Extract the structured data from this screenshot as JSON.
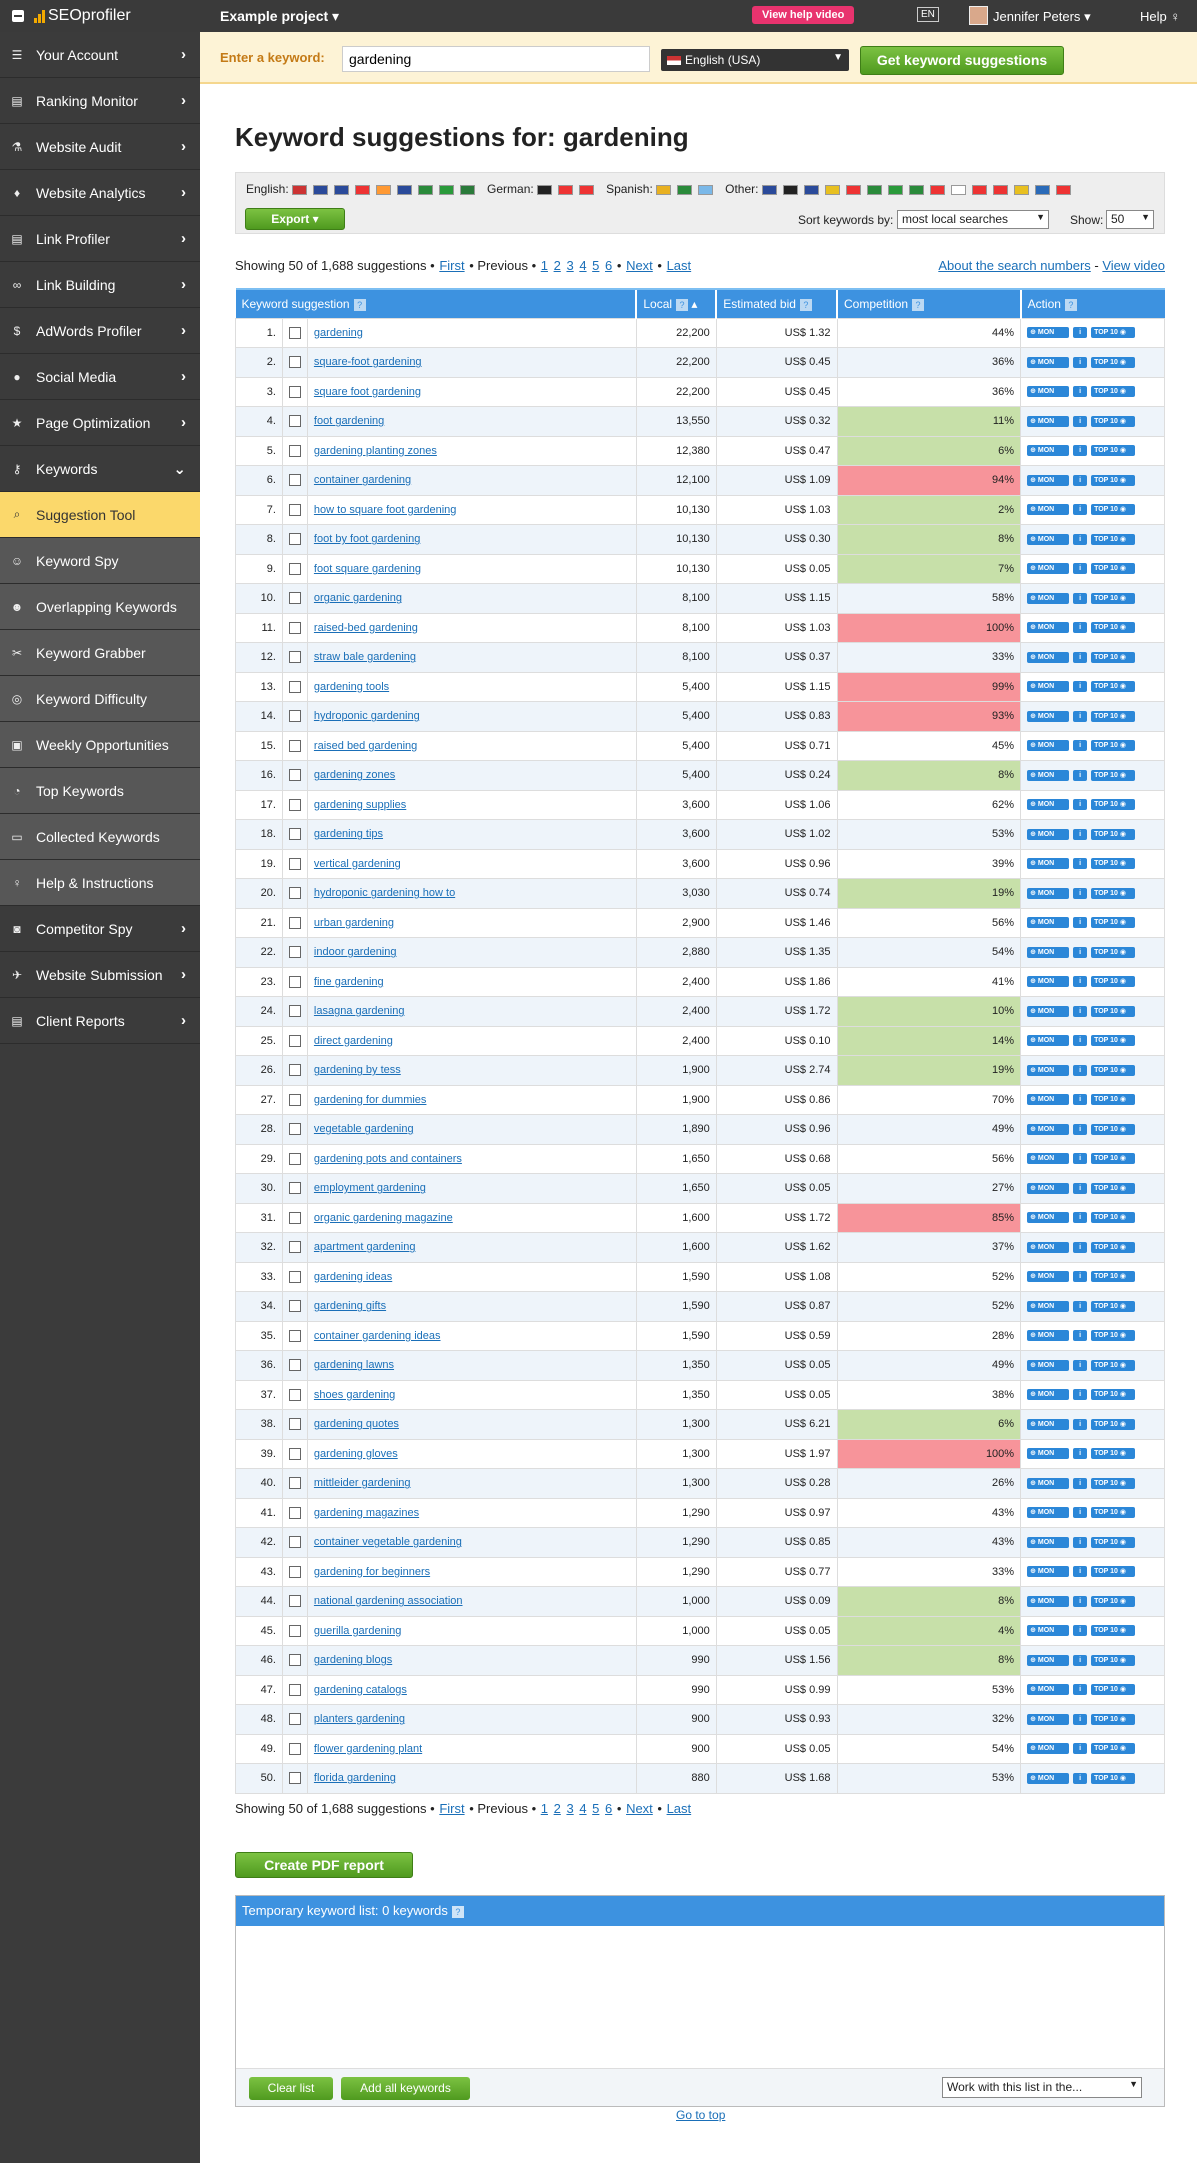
{
  "topbar": {
    "brand": "SEOprofiler",
    "project": "Example project",
    "help_video": "View help video",
    "lang": "EN",
    "user": "Jennifer Peters",
    "help": "Help"
  },
  "sidebar": {
    "items": [
      {
        "label": "Your Account",
        "icon": "list-icon",
        "chevron": ">"
      },
      {
        "label": "Ranking Monitor",
        "icon": "chart-icon",
        "chevron": ">"
      },
      {
        "label": "Website Audit",
        "icon": "flask-icon",
        "chevron": ">"
      },
      {
        "label": "Website Analytics",
        "icon": "pin-icon",
        "chevron": ">"
      },
      {
        "label": "Link Profiler",
        "icon": "chart-icon",
        "chevron": ">"
      },
      {
        "label": "Link Building",
        "icon": "link-icon",
        "chevron": ">"
      },
      {
        "label": "AdWords Profiler",
        "icon": "dollar-icon",
        "chevron": ">"
      },
      {
        "label": "Social Media",
        "icon": "comment-icon",
        "chevron": ">"
      },
      {
        "label": "Page Optimization",
        "icon": "star-icon",
        "chevron": ">"
      },
      {
        "label": "Keywords",
        "icon": "key-icon",
        "chevron": "v"
      }
    ],
    "subitems": [
      {
        "label": "Suggestion Tool",
        "icon": "search-icon",
        "active": true
      },
      {
        "label": "Keyword Spy",
        "icon": "user-icon"
      },
      {
        "label": "Overlapping Keywords",
        "icon": "users-icon"
      },
      {
        "label": "Keyword Grabber",
        "icon": "scissors-icon"
      },
      {
        "label": "Keyword Difficulty",
        "icon": "target-icon"
      },
      {
        "label": "Weekly Opportunities",
        "icon": "gift-icon"
      },
      {
        "label": "Top Keywords",
        "icon": "pie-icon"
      },
      {
        "label": "Collected Keywords",
        "icon": "inbox-icon"
      },
      {
        "label": "Help & Instructions",
        "icon": "bulb-icon"
      }
    ],
    "items2": [
      {
        "label": "Competitor Spy",
        "icon": "camera-icon",
        "chevron": ">"
      },
      {
        "label": "Website Submission",
        "icon": "plane-icon",
        "chevron": ">"
      },
      {
        "label": "Client Reports",
        "icon": "doc-icon",
        "chevron": ">"
      }
    ]
  },
  "keyword_bar": {
    "label": "Enter a keyword:",
    "value": "gardening",
    "language": "English (USA)",
    "button": "Get keyword suggestions"
  },
  "main": {
    "title": "Keyword suggestions for: gardening",
    "lang_groups": [
      {
        "label": "English:",
        "flags": [
          "#c33",
          "#2a4a9a",
          "#2a4a9a",
          "#e33",
          "#f93",
          "#2a4a9a",
          "#2a8a3a",
          "#2a9a3a",
          "#2a7a3a"
        ]
      },
      {
        "label": "German:",
        "flags": [
          "#222",
          "#e33",
          "#e33"
        ]
      },
      {
        "label": "Spanish:",
        "flags": [
          "#e8b020",
          "#2a8a3a",
          "#7ab8e8"
        ]
      },
      {
        "label": "Other:",
        "flags": [
          "#2a4a9a",
          "#222",
          "#2a4a9a",
          "#e8c020",
          "#e33",
          "#2a8a3a",
          "#2a9a3a",
          "#2a8a3a",
          "#e33",
          "#fff",
          "#e33",
          "#e33",
          "#e8c020",
          "#2a6ab8",
          "#e33"
        ]
      }
    ],
    "export": "Export",
    "sort_label": "Sort keywords by:",
    "sort_value": "most local searches",
    "show_label": "Show:",
    "show_value": "50",
    "pager": {
      "showing": "Showing 50 of 1,688 suggestions",
      "first": "First",
      "previous": "Previous",
      "pages": [
        "1",
        "2",
        "3",
        "4",
        "5",
        "6"
      ],
      "next": "Next",
      "last": "Last"
    },
    "about": "About the search numbers",
    "view_video": "View video",
    "columns": [
      "Keyword suggestion",
      "Local",
      "Estimated bid",
      "Competition",
      "Action"
    ],
    "actions": {
      "mon": "MON",
      "info": "i",
      "top": "TOP 10"
    },
    "rows": [
      {
        "n": "1.",
        "kw": "gardening",
        "local": "22,200",
        "bid": "US$ 1.32",
        "comp": "44%",
        "c": ""
      },
      {
        "n": "2.",
        "kw": "square-foot gardening",
        "local": "22,200",
        "bid": "US$ 0.45",
        "comp": "36%",
        "c": ""
      },
      {
        "n": "3.",
        "kw": "square foot gardening",
        "local": "22,200",
        "bid": "US$ 0.45",
        "comp": "36%",
        "c": ""
      },
      {
        "n": "4.",
        "kw": "foot gardening",
        "local": "13,550",
        "bid": "US$ 0.32",
        "comp": "11%",
        "c": "green"
      },
      {
        "n": "5.",
        "kw": "gardening planting zones",
        "local": "12,380",
        "bid": "US$ 0.47",
        "comp": "6%",
        "c": "green"
      },
      {
        "n": "6.",
        "kw": "container gardening",
        "local": "12,100",
        "bid": "US$ 1.09",
        "comp": "94%",
        "c": "red"
      },
      {
        "n": "7.",
        "kw": "how to square foot gardening",
        "local": "10,130",
        "bid": "US$ 1.03",
        "comp": "2%",
        "c": "green"
      },
      {
        "n": "8.",
        "kw": "foot by foot gardening",
        "local": "10,130",
        "bid": "US$ 0.30",
        "comp": "8%",
        "c": "green"
      },
      {
        "n": "9.",
        "kw": "foot square gardening",
        "local": "10,130",
        "bid": "US$ 0.05",
        "comp": "7%",
        "c": "green"
      },
      {
        "n": "10.",
        "kw": "organic gardening",
        "local": "8,100",
        "bid": "US$ 1.15",
        "comp": "58%",
        "c": ""
      },
      {
        "n": "11.",
        "kw": "raised-bed gardening",
        "local": "8,100",
        "bid": "US$ 1.03",
        "comp": "100%",
        "c": "red"
      },
      {
        "n": "12.",
        "kw": "straw bale gardening",
        "local": "8,100",
        "bid": "US$ 0.37",
        "comp": "33%",
        "c": ""
      },
      {
        "n": "13.",
        "kw": "gardening tools",
        "local": "5,400",
        "bid": "US$ 1.15",
        "comp": "99%",
        "c": "red"
      },
      {
        "n": "14.",
        "kw": "hydroponic gardening",
        "local": "5,400",
        "bid": "US$ 0.83",
        "comp": "93%",
        "c": "red"
      },
      {
        "n": "15.",
        "kw": "raised bed gardening",
        "local": "5,400",
        "bid": "US$ 0.71",
        "comp": "45%",
        "c": ""
      },
      {
        "n": "16.",
        "kw": "gardening zones",
        "local": "5,400",
        "bid": "US$ 0.24",
        "comp": "8%",
        "c": "green"
      },
      {
        "n": "17.",
        "kw": "gardening supplies",
        "local": "3,600",
        "bid": "US$ 1.06",
        "comp": "62%",
        "c": ""
      },
      {
        "n": "18.",
        "kw": "gardening tips",
        "local": "3,600",
        "bid": "US$ 1.02",
        "comp": "53%",
        "c": ""
      },
      {
        "n": "19.",
        "kw": "vertical gardening",
        "local": "3,600",
        "bid": "US$ 0.96",
        "comp": "39%",
        "c": ""
      },
      {
        "n": "20.",
        "kw": "hydroponic gardening how to",
        "local": "3,030",
        "bid": "US$ 0.74",
        "comp": "19%",
        "c": "green"
      },
      {
        "n": "21.",
        "kw": "urban gardening",
        "local": "2,900",
        "bid": "US$ 1.46",
        "comp": "56%",
        "c": ""
      },
      {
        "n": "22.",
        "kw": "indoor gardening",
        "local": "2,880",
        "bid": "US$ 1.35",
        "comp": "54%",
        "c": ""
      },
      {
        "n": "23.",
        "kw": "fine gardening",
        "local": "2,400",
        "bid": "US$ 1.86",
        "comp": "41%",
        "c": ""
      },
      {
        "n": "24.",
        "kw": "lasagna gardening",
        "local": "2,400",
        "bid": "US$ 1.72",
        "comp": "10%",
        "c": "green"
      },
      {
        "n": "25.",
        "kw": "direct gardening",
        "local": "2,400",
        "bid": "US$ 0.10",
        "comp": "14%",
        "c": "green"
      },
      {
        "n": "26.",
        "kw": "gardening by tess",
        "local": "1,900",
        "bid": "US$ 2.74",
        "comp": "19%",
        "c": "green"
      },
      {
        "n": "27.",
        "kw": "gardening for dummies",
        "local": "1,900",
        "bid": "US$ 0.86",
        "comp": "70%",
        "c": ""
      },
      {
        "n": "28.",
        "kw": "vegetable gardening",
        "local": "1,890",
        "bid": "US$ 0.96",
        "comp": "49%",
        "c": ""
      },
      {
        "n": "29.",
        "kw": "gardening pots and containers",
        "local": "1,650",
        "bid": "US$ 0.68",
        "comp": "56%",
        "c": ""
      },
      {
        "n": "30.",
        "kw": "employment gardening",
        "local": "1,650",
        "bid": "US$ 0.05",
        "comp": "27%",
        "c": ""
      },
      {
        "n": "31.",
        "kw": "organic gardening magazine",
        "local": "1,600",
        "bid": "US$ 1.72",
        "comp": "85%",
        "c": "red"
      },
      {
        "n": "32.",
        "kw": "apartment gardening",
        "local": "1,600",
        "bid": "US$ 1.62",
        "comp": "37%",
        "c": ""
      },
      {
        "n": "33.",
        "kw": "gardening ideas",
        "local": "1,590",
        "bid": "US$ 1.08",
        "comp": "52%",
        "c": ""
      },
      {
        "n": "34.",
        "kw": "gardening gifts",
        "local": "1,590",
        "bid": "US$ 0.87",
        "comp": "52%",
        "c": ""
      },
      {
        "n": "35.",
        "kw": "container gardening ideas",
        "local": "1,590",
        "bid": "US$ 0.59",
        "comp": "28%",
        "c": ""
      },
      {
        "n": "36.",
        "kw": "gardening lawns",
        "local": "1,350",
        "bid": "US$ 0.05",
        "comp": "49%",
        "c": ""
      },
      {
        "n": "37.",
        "kw": "shoes gardening",
        "local": "1,350",
        "bid": "US$ 0.05",
        "comp": "38%",
        "c": ""
      },
      {
        "n": "38.",
        "kw": "gardening quotes",
        "local": "1,300",
        "bid": "US$ 6.21",
        "comp": "6%",
        "c": "green"
      },
      {
        "n": "39.",
        "kw": "gardening gloves",
        "local": "1,300",
        "bid": "US$ 1.97",
        "comp": "100%",
        "c": "red"
      },
      {
        "n": "40.",
        "kw": "mittleider gardening",
        "local": "1,300",
        "bid": "US$ 0.28",
        "comp": "26%",
        "c": ""
      },
      {
        "n": "41.",
        "kw": "gardening magazines",
        "local": "1,290",
        "bid": "US$ 0.97",
        "comp": "43%",
        "c": ""
      },
      {
        "n": "42.",
        "kw": "container vegetable gardening",
        "local": "1,290",
        "bid": "US$ 0.85",
        "comp": "43%",
        "c": ""
      },
      {
        "n": "43.",
        "kw": "gardening for beginners",
        "local": "1,290",
        "bid": "US$ 0.77",
        "comp": "33%",
        "c": ""
      },
      {
        "n": "44.",
        "kw": "national gardening association",
        "local": "1,000",
        "bid": "US$ 0.09",
        "comp": "8%",
        "c": "green"
      },
      {
        "n": "45.",
        "kw": "guerilla gardening",
        "local": "1,000",
        "bid": "US$ 0.05",
        "comp": "4%",
        "c": "green"
      },
      {
        "n": "46.",
        "kw": "gardening blogs",
        "local": "990",
        "bid": "US$ 1.56",
        "comp": "8%",
        "c": "green"
      },
      {
        "n": "47.",
        "kw": "gardening catalogs",
        "local": "990",
        "bid": "US$ 0.99",
        "comp": "53%",
        "c": ""
      },
      {
        "n": "48.",
        "kw": "planters gardening",
        "local": "900",
        "bid": "US$ 0.93",
        "comp": "32%",
        "c": ""
      },
      {
        "n": "49.",
        "kw": "flower gardening plant",
        "local": "900",
        "bid": "US$ 0.05",
        "comp": "54%",
        "c": ""
      },
      {
        "n": "50.",
        "kw": "florida gardening",
        "local": "880",
        "bid": "US$ 1.68",
        "comp": "53%",
        "c": ""
      }
    ],
    "pdf_button": "Create PDF report",
    "temp_list_title": "Temporary keyword list: 0 keywords",
    "clear_list": "Clear list",
    "add_all": "Add all keywords",
    "work_with": "Work with this list in the...",
    "go_top": "Go to top"
  },
  "colors": {
    "green": "#c7e0a9",
    "red": "#f7949a",
    "header_blue": "#3d92e0",
    "active_yellow": "#fbd86b"
  }
}
